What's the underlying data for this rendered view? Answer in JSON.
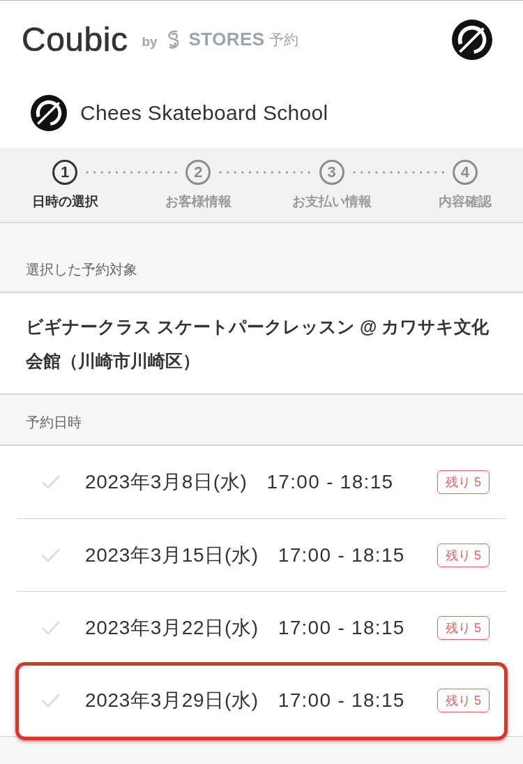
{
  "header": {
    "brand": "Coubic",
    "by": "by",
    "partner": "STORES",
    "partner_suffix": "予約"
  },
  "shop": {
    "name": "Chees Skateboard School"
  },
  "steps": [
    {
      "number": "1",
      "label": "日時の選択",
      "selected": true
    },
    {
      "number": "2",
      "label": "お客様情報",
      "selected": false
    },
    {
      "number": "3",
      "label": "お支払い情報",
      "selected": false
    },
    {
      "number": "4",
      "label": "内容確認",
      "selected": false
    }
  ],
  "selected_item": {
    "heading": "選択した予約対象",
    "title": "ビギナークラス スケートパークレッスン @ カワサキ文化会館（川崎市川崎区）"
  },
  "schedule": {
    "heading": "予約日時",
    "slots": [
      {
        "date": "2023年3月8日(水)",
        "time": "17:00 - 18:15",
        "remaining": "残り 5",
        "checked": false,
        "highlighted": false
      },
      {
        "date": "2023年3月15日(水)",
        "time": "17:00 - 18:15",
        "remaining": "残り 5",
        "checked": false,
        "highlighted": false
      },
      {
        "date": "2023年3月22日(水)",
        "time": "17:00 - 18:15",
        "remaining": "残り 5",
        "checked": false,
        "highlighted": false
      },
      {
        "date": "2023年3月29日(水)",
        "time": "17:00 - 18:15",
        "remaining": "残り 5",
        "checked": false,
        "highlighted": true
      }
    ]
  }
}
